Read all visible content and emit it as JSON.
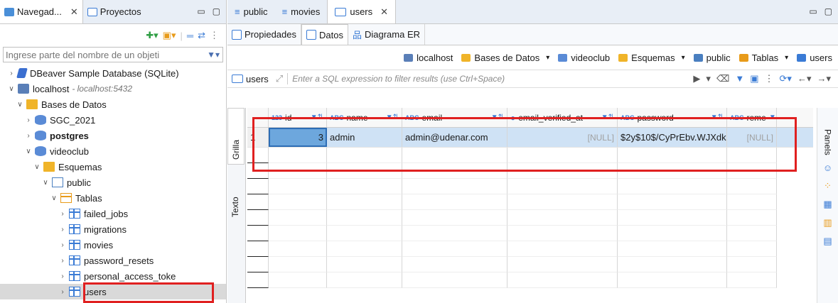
{
  "left_panel": {
    "tabs": [
      {
        "label": "Navegad...",
        "active": true
      },
      {
        "label": "Proyectos",
        "active": false
      }
    ],
    "filter_placeholder": "Ingrese parte del nombre de un objeti",
    "tree": [
      {
        "label": "DBeaver Sample Database (SQLite)",
        "level": 0,
        "arrow": ">",
        "icon": "sqlite-db-icon"
      },
      {
        "label": "localhost",
        "sublabel": "- localhost:5432",
        "level": 0,
        "arrow": "v",
        "icon": "host-icon"
      },
      {
        "label": "Bases de Datos",
        "level": 1,
        "arrow": "v",
        "icon": "folder-icon"
      },
      {
        "label": "SGC_2021",
        "level": 2,
        "arrow": ">",
        "icon": "database-icon"
      },
      {
        "label": "postgres",
        "level": 2,
        "arrow": ">",
        "icon": "database-icon",
        "bold": true
      },
      {
        "label": "videoclub",
        "level": 2,
        "arrow": "v",
        "icon": "database-icon"
      },
      {
        "label": "Esquemas",
        "level": 3,
        "arrow": "v",
        "icon": "folder-icon"
      },
      {
        "label": "public",
        "level": 4,
        "arrow": "v",
        "icon": "schema-icon"
      },
      {
        "label": "Tablas",
        "level": 5,
        "arrow": "v",
        "icon": "tables-folder-icon"
      },
      {
        "label": "failed_jobs",
        "level": 6,
        "arrow": ">",
        "icon": "table-icon"
      },
      {
        "label": "migrations",
        "level": 6,
        "arrow": ">",
        "icon": "table-icon"
      },
      {
        "label": "movies",
        "level": 6,
        "arrow": ">",
        "icon": "table-icon"
      },
      {
        "label": "password_resets",
        "level": 6,
        "arrow": ">",
        "icon": "table-icon"
      },
      {
        "label": "personal_access_toke",
        "level": 6,
        "arrow": ">",
        "icon": "table-icon"
      },
      {
        "label": "users",
        "level": 6,
        "arrow": ">",
        "icon": "table-icon",
        "selected": true
      }
    ]
  },
  "editor": {
    "tabs": [
      {
        "label": "public",
        "active": false
      },
      {
        "label": "movies",
        "active": false
      },
      {
        "label": "users",
        "active": true
      }
    ],
    "sub_tabs": [
      {
        "label": "Propiedades",
        "active": false
      },
      {
        "label": "Datos",
        "active": true
      },
      {
        "label": "Diagrama ER",
        "active": false
      }
    ],
    "breadcrumb": [
      {
        "label": "localhost",
        "dropdown": false
      },
      {
        "label": "Bases de Datos",
        "dropdown": true
      },
      {
        "label": "videoclub",
        "dropdown": false
      },
      {
        "label": "Esquemas",
        "dropdown": true
      },
      {
        "label": "public",
        "dropdown": false
      },
      {
        "label": "Tablas",
        "dropdown": true
      },
      {
        "label": "users",
        "dropdown": false
      }
    ],
    "filter_table": "users",
    "filter_placeholder": "Enter a SQL expression to filter results (use Ctrl+Space)",
    "vertical_tabs": [
      "Grilla",
      "Texto"
    ],
    "side_label": "Panels"
  },
  "grid": {
    "columns": [
      {
        "type": "123",
        "name": "id"
      },
      {
        "type": "ABC",
        "name": "name"
      },
      {
        "type": "ABC",
        "name": "email"
      },
      {
        "type": "",
        "name": "email_verified_at"
      },
      {
        "type": "ABC",
        "name": "password"
      },
      {
        "type": "ABC",
        "name": "reme"
      }
    ],
    "rows": [
      {
        "rownum": "1",
        "id": "3",
        "name": "admin",
        "email": "admin@udenar.com",
        "email_verified_at": "[NULL]",
        "password": "$2y$10$/CyPrEbv.WJXdk",
        "reme": "[NULL]"
      }
    ]
  },
  "colors": {
    "accent": "#3a7bd5",
    "highlight": "#e02020",
    "selection": "#cfe2f5"
  }
}
